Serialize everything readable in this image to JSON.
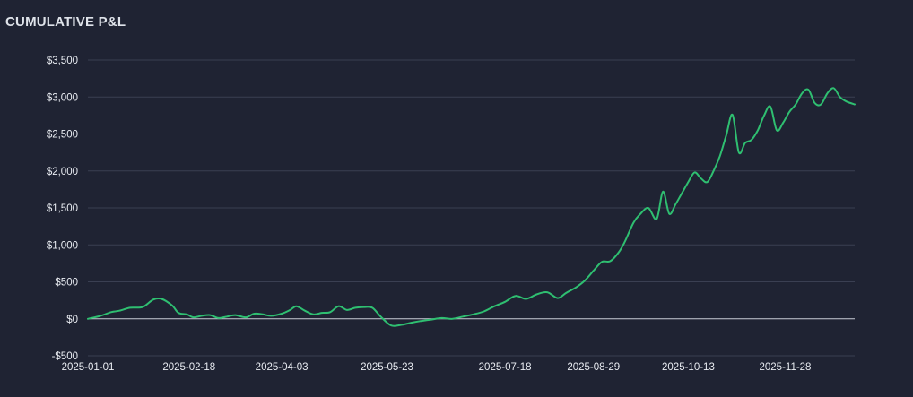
{
  "panel": {
    "title": "CUMULATIVE P&L"
  },
  "chart_data": {
    "type": "line",
    "title": "CUMULATIVE P&L",
    "xlabel": "",
    "ylabel": "",
    "grid": true,
    "legend": "none",
    "ylim": [
      -500,
      3500
    ],
    "xlim": [
      "2025-01-01",
      "2025-12-31"
    ],
    "y_ticks": [
      -500,
      0,
      500,
      1000,
      1500,
      2000,
      2500,
      3000,
      3500
    ],
    "y_tick_labels": [
      "-$500",
      "$0",
      "$500",
      "$1,000",
      "$1,500",
      "$2,000",
      "$2,500",
      "$3,000",
      "$3,500"
    ],
    "x_tick_labels": [
      "2025-01-01",
      "2025-02-18",
      "2025-04-03",
      "2025-05-23",
      "2025-07-18",
      "2025-08-29",
      "2025-10-13",
      "2025-11-28"
    ],
    "colors": {
      "line": "#2fbf71",
      "grid": "#3a3f52",
      "zero_line": "#c9ccd6",
      "background": "#1f2333"
    },
    "series": [
      {
        "x": [
          "2025-01-01",
          "2025-01-07",
          "2025-01-12",
          "2025-01-16",
          "2025-01-21",
          "2025-01-27",
          "2025-02-01",
          "2025-02-05",
          "2025-02-10",
          "2025-02-13",
          "2025-02-17",
          "2025-02-20",
          "2025-02-24",
          "2025-02-28",
          "2025-03-04",
          "2025-03-08",
          "2025-03-12",
          "2025-03-17",
          "2025-03-21",
          "2025-03-25",
          "2025-03-29",
          "2025-04-03",
          "2025-04-07",
          "2025-04-10",
          "2025-04-14",
          "2025-04-18",
          "2025-04-22",
          "2025-04-26",
          "2025-04-30",
          "2025-05-04",
          "2025-05-08",
          "2025-05-12",
          "2025-05-16",
          "2025-05-20",
          "2025-05-25",
          "2025-05-30",
          "2025-06-04",
          "2025-06-08",
          "2025-06-13",
          "2025-06-18",
          "2025-06-23",
          "2025-06-28",
          "2025-07-03",
          "2025-07-08",
          "2025-07-13",
          "2025-07-18",
          "2025-07-23",
          "2025-07-28",
          "2025-08-02",
          "2025-08-07",
          "2025-08-12",
          "2025-08-16",
          "2025-08-21",
          "2025-08-25",
          "2025-08-29",
          "2025-09-02",
          "2025-09-06",
          "2025-09-10",
          "2025-09-13",
          "2025-09-17",
          "2025-09-20",
          "2025-09-24",
          "2025-09-28",
          "2025-10-01",
          "2025-10-04",
          "2025-10-07",
          "2025-10-10",
          "2025-10-13",
          "2025-10-16",
          "2025-10-19",
          "2025-10-22",
          "2025-10-25",
          "2025-10-28",
          "2025-10-31",
          "2025-11-03",
          "2025-11-06",
          "2025-11-09",
          "2025-11-12",
          "2025-11-15",
          "2025-11-18",
          "2025-11-21",
          "2025-11-24",
          "2025-11-27",
          "2025-11-30",
          "2025-12-03",
          "2025-12-06",
          "2025-12-09",
          "2025-12-12",
          "2025-12-15",
          "2025-12-18",
          "2025-12-21",
          "2025-12-24",
          "2025-12-27",
          "2025-12-31"
        ],
        "y": [
          0,
          40,
          90,
          110,
          150,
          160,
          260,
          270,
          180,
          80,
          60,
          20,
          40,
          50,
          10,
          30,
          50,
          20,
          70,
          60,
          40,
          70,
          120,
          170,
          110,
          60,
          80,
          90,
          170,
          120,
          150,
          160,
          150,
          30,
          -90,
          -80,
          -50,
          -30,
          -10,
          10,
          0,
          30,
          60,
          100,
          170,
          230,
          310,
          270,
          330,
          360,
          280,
          350,
          430,
          520,
          650,
          770,
          780,
          900,
          1050,
          1300,
          1410,
          1500,
          1350,
          1720,
          1420,
          1550,
          1700,
          1850,
          1980,
          1900,
          1850,
          2000,
          2200,
          2480,
          2760,
          2250,
          2380,
          2420,
          2550,
          2750,
          2870,
          2550,
          2650,
          2800,
          2900,
          3050,
          3100,
          2920,
          2900,
          3050,
          3120,
          3000,
          2940,
          2900
        ]
      }
    ]
  }
}
